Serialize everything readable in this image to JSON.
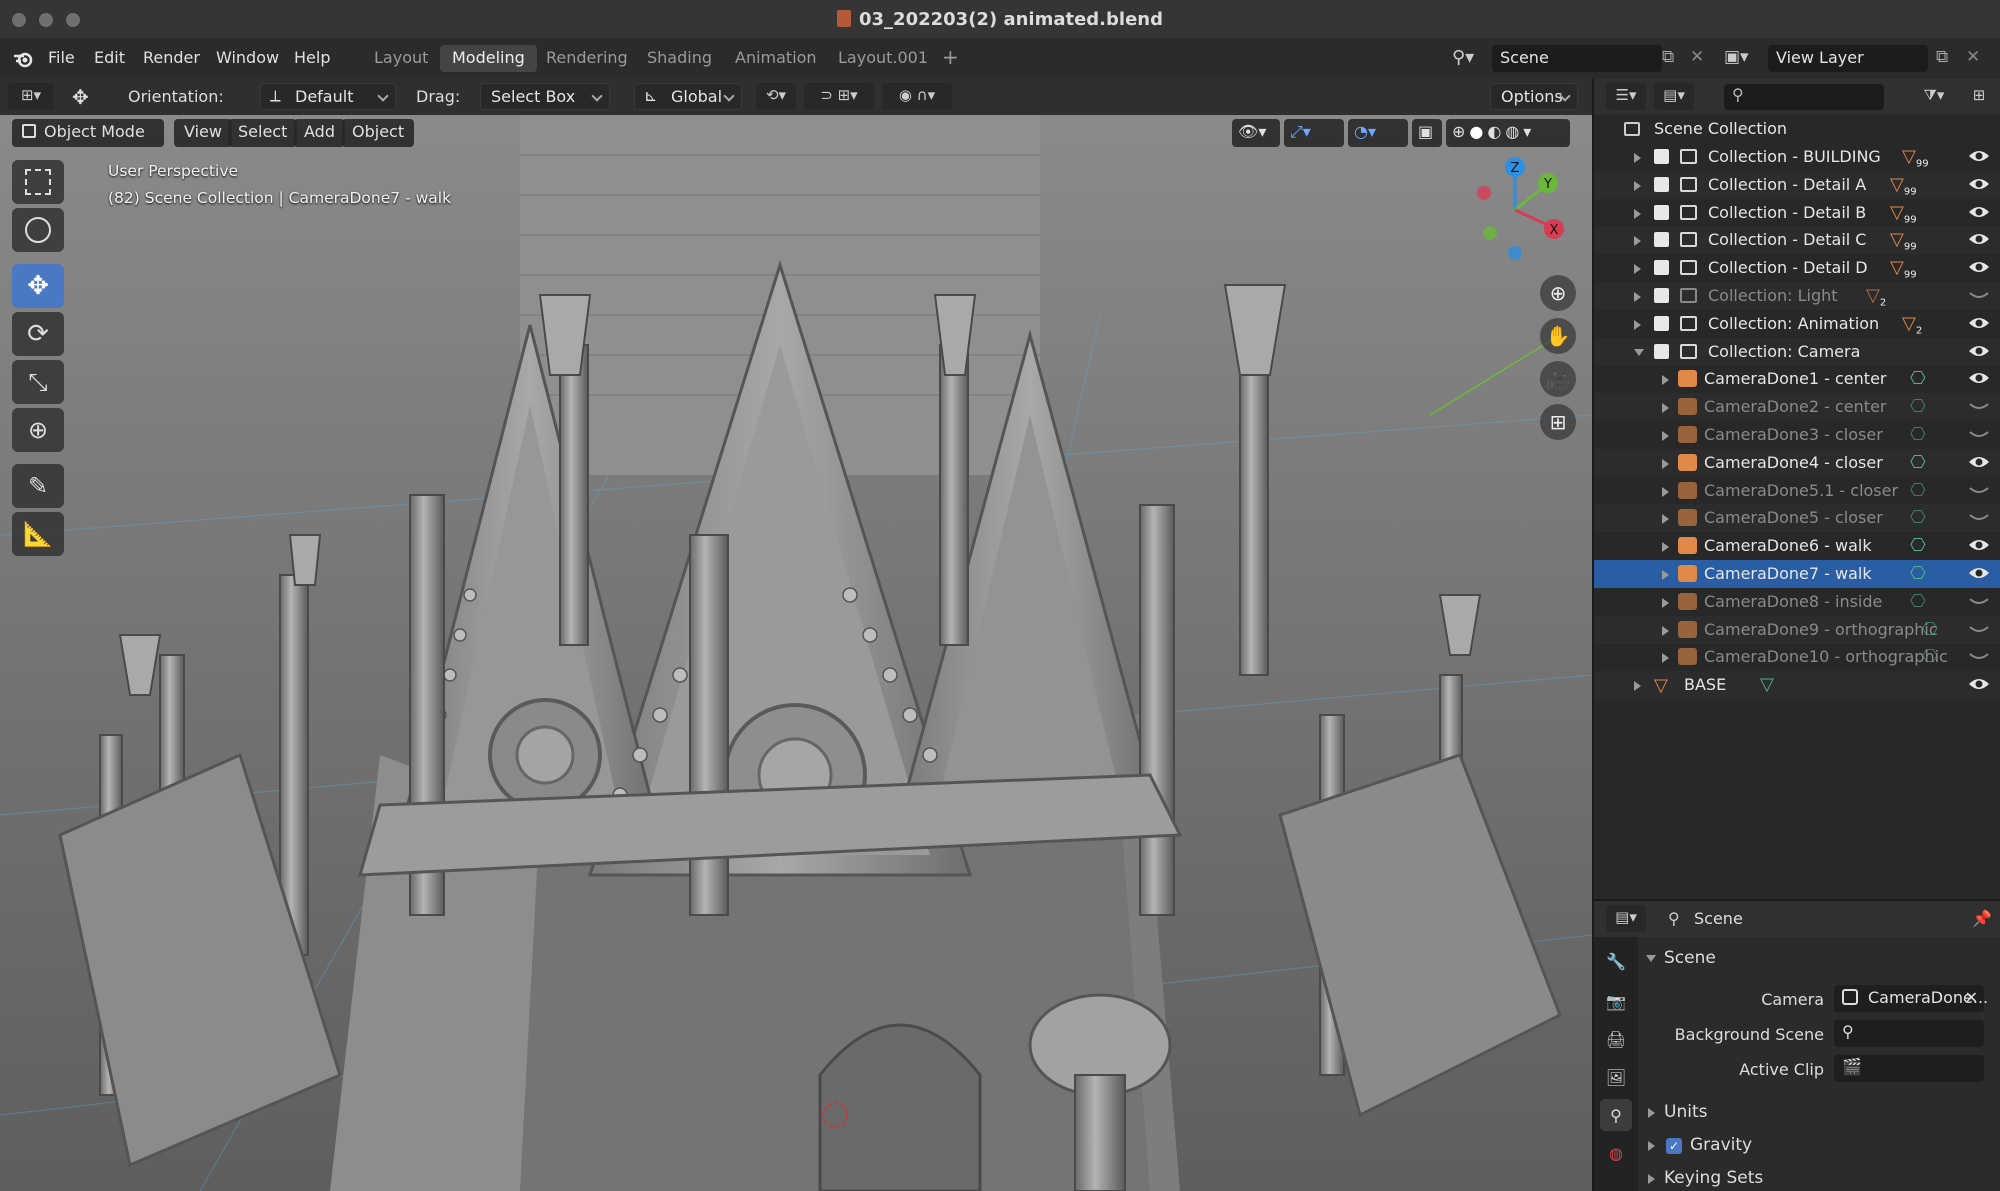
{
  "window": {
    "title": "03_202203(2) animated.blend"
  },
  "menu": {
    "items": [
      "File",
      "Edit",
      "Render",
      "Window",
      "Help"
    ]
  },
  "workspaces": {
    "tabs": [
      "Layout",
      "Modeling",
      "Rendering",
      "Shading",
      "Animation",
      "Layout.001"
    ],
    "active_index": 1,
    "add_label": "+"
  },
  "scene_selector": {
    "value": "Scene"
  },
  "view_layer": {
    "value": "View Layer"
  },
  "tool_header": {
    "orientation_label": "Orientation:",
    "orientation_value": "Default",
    "drag_label": "Drag:",
    "drag_value": "Select Box",
    "transform_orientation": "Global",
    "options_label": "Options"
  },
  "viewport_header": {
    "mode": "Object Mode",
    "menus": [
      "View",
      "Select",
      "Add",
      "Object"
    ]
  },
  "viewport": {
    "perspective_label": "User Perspective",
    "context_label": "(82) Scene Collection | CameraDone7 - walk"
  },
  "gizmo": {
    "x": "X",
    "y": "Y",
    "z": "Z"
  },
  "tools": [
    "select-box",
    "cursor",
    "move",
    "rotate",
    "scale",
    "transform",
    "annotate",
    "measure"
  ],
  "outliner": {
    "search_placeholder": "",
    "root": "Scene Collection",
    "rows": [
      {
        "label": "Collection - BUILDING",
        "badge": "99",
        "visible": true,
        "dim": false,
        "indent": 1,
        "checked": true,
        "type": "collection"
      },
      {
        "label": "Collection - Detail A",
        "badge": "99",
        "visible": true,
        "dim": false,
        "indent": 1,
        "checked": true,
        "type": "collection"
      },
      {
        "label": "Collection - Detail B",
        "badge": "99",
        "visible": true,
        "dim": false,
        "indent": 1,
        "checked": true,
        "type": "collection"
      },
      {
        "label": "Collection - Detail C",
        "badge": "99",
        "visible": true,
        "dim": false,
        "indent": 1,
        "checked": true,
        "type": "collection"
      },
      {
        "label": "Collection - Detail D",
        "badge": "99",
        "visible": true,
        "dim": false,
        "indent": 1,
        "checked": true,
        "type": "collection"
      },
      {
        "label": "Collection: Light",
        "badge": "2",
        "visible": false,
        "dim": true,
        "indent": 1,
        "checked": true,
        "type": "collection"
      },
      {
        "label": "Collection: Animation",
        "badge": "2",
        "visible": true,
        "dim": false,
        "indent": 1,
        "checked": true,
        "type": "collection"
      },
      {
        "label": "Collection: Camera",
        "badge": "",
        "visible": true,
        "dim": false,
        "indent": 1,
        "checked": true,
        "type": "collection",
        "expanded": true
      },
      {
        "label": "CameraDone1 - center",
        "visible": true,
        "dim": false,
        "indent": 2,
        "type": "camera"
      },
      {
        "label": "CameraDone2 - center",
        "visible": false,
        "dim": true,
        "indent": 2,
        "type": "camera"
      },
      {
        "label": "CameraDone3 - closer",
        "visible": false,
        "dim": true,
        "indent": 2,
        "type": "camera"
      },
      {
        "label": "CameraDone4 - closer",
        "visible": true,
        "dim": false,
        "indent": 2,
        "type": "camera"
      },
      {
        "label": "CameraDone5.1 - closer",
        "visible": false,
        "dim": true,
        "indent": 2,
        "type": "camera"
      },
      {
        "label": "CameraDone5 - closer",
        "visible": false,
        "dim": true,
        "indent": 2,
        "type": "camera"
      },
      {
        "label": "CameraDone6 - walk",
        "visible": true,
        "dim": false,
        "indent": 2,
        "type": "camera"
      },
      {
        "label": "CameraDone7 - walk",
        "visible": true,
        "dim": false,
        "indent": 2,
        "type": "camera",
        "selected": true
      },
      {
        "label": "CameraDone8 - inside",
        "visible": false,
        "dim": true,
        "indent": 2,
        "type": "camera"
      },
      {
        "label": "CameraDone9 - orthographic",
        "visible": false,
        "dim": true,
        "indent": 2,
        "type": "camera"
      },
      {
        "label": "CameraDone10 - orthographic",
        "visible": false,
        "dim": true,
        "indent": 2,
        "type": "camera"
      },
      {
        "label": "BASE",
        "visible": true,
        "dim": false,
        "indent": 0,
        "type": "mesh"
      }
    ]
  },
  "properties": {
    "context": "Scene",
    "section": "Scene",
    "camera_label": "Camera",
    "camera_value": "CameraDone...",
    "background_label": "Background Scene",
    "background_value": "",
    "clip_label": "Active Clip",
    "clip_value": "",
    "units_label": "Units",
    "gravity_label": "Gravity",
    "gravity_checked": true,
    "keying_label": "Keying Sets"
  },
  "colors": {
    "accent": "#4a78c2",
    "selection": "#2a5ea4",
    "camera_icon": "#e08a4a",
    "camera_data": "#4fb38b",
    "viewport_bg": "#6d6d6d"
  }
}
